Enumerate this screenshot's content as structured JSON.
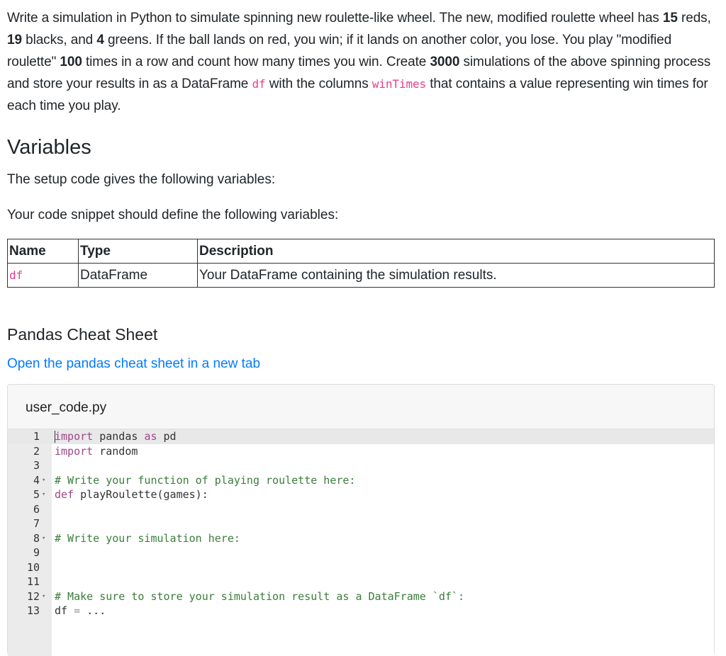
{
  "intro": {
    "t1": "Write a simulation in Python to simulate spinning new roulette-like wheel. The new, modified roulette wheel has ",
    "n_red": "15",
    "t2": " reds, ",
    "n_black": "19",
    "t3": " blacks, and ",
    "n_green": "4",
    "t4": " greens. If the ball lands on red, you win; if it lands on another color, you lose. You play \"modified roulette\" ",
    "n_plays": "100",
    "t5": " times in a row and count how many times you win. Create ",
    "n_sims": "3000",
    "t6": " simulations of the above spinning process and store your results in as a DataFrame ",
    "code_df": "df",
    "t7": " with the columns ",
    "code_col": "winTimes",
    "t8": " that contains a value representing win times for each time you play."
  },
  "variables": {
    "heading": "Variables",
    "setup_text": "The setup code gives the following variables:",
    "define_text": "Your code snippet should define the following variables:",
    "table": {
      "headers": [
        "Name",
        "Type",
        "Description"
      ],
      "rows": [
        {
          "name": "df",
          "type": "DataFrame",
          "description": "Your DataFrame containing the simulation results."
        }
      ]
    }
  },
  "cheatsheet": {
    "heading": "Pandas Cheat Sheet",
    "link": "Open the pandas cheat sheet in a new tab"
  },
  "editor": {
    "filename": "user_code.py",
    "lines": [
      {
        "n": "1",
        "fold": "",
        "segments": [
          [
            "kw",
            "import"
          ],
          [
            "p",
            " pandas "
          ],
          [
            "kw",
            "as"
          ],
          [
            "p",
            " pd"
          ]
        ]
      },
      {
        "n": "2",
        "fold": "",
        "segments": [
          [
            "kw",
            "import"
          ],
          [
            "p",
            " random"
          ]
        ]
      },
      {
        "n": "3",
        "fold": "",
        "segments": []
      },
      {
        "n": "4",
        "fold": "▾",
        "segments": [
          [
            "cm",
            "# Write your function of playing roulette here:"
          ]
        ]
      },
      {
        "n": "5",
        "fold": "▾",
        "segments": [
          [
            "kw",
            "def"
          ],
          [
            "p",
            " playRoulette(games):"
          ]
        ]
      },
      {
        "n": "6",
        "fold": "",
        "segments": []
      },
      {
        "n": "7",
        "fold": "",
        "segments": []
      },
      {
        "n": "8",
        "fold": "▾",
        "segments": [
          [
            "cm",
            "# Write your simulation here:"
          ]
        ]
      },
      {
        "n": "9",
        "fold": "",
        "segments": []
      },
      {
        "n": "10",
        "fold": "",
        "segments": []
      },
      {
        "n": "11",
        "fold": "",
        "segments": []
      },
      {
        "n": "12",
        "fold": "▾",
        "segments": [
          [
            "cm",
            "# Make sure to store your simulation result as a DataFrame `df`:"
          ]
        ]
      },
      {
        "n": "13",
        "fold": "",
        "segments": [
          [
            "p",
            "df "
          ],
          [
            "op",
            "="
          ],
          [
            "p",
            " ..."
          ]
        ]
      }
    ]
  }
}
